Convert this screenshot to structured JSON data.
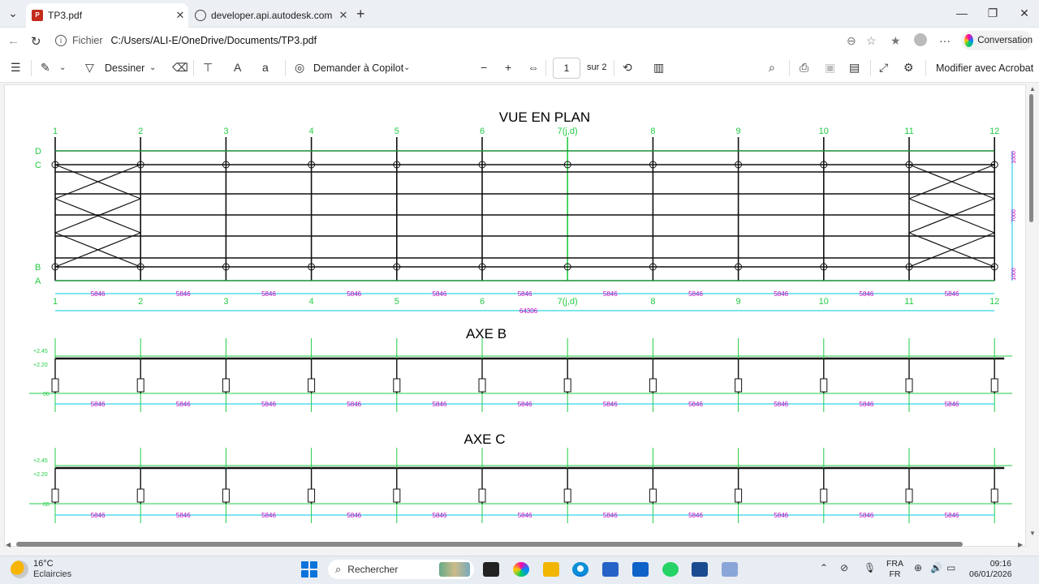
{
  "browser": {
    "tabs": [
      {
        "title": "TP3.pdf",
        "active": true
      },
      {
        "title": "developer.api.autodesk.com",
        "active": false
      }
    ],
    "address": {
      "protocol": "Fichier",
      "url": "C:/Users/ALI-E/OneDrive/Documents/TP3.pdf"
    },
    "copilot_label": "Conversation"
  },
  "pdf_toolbar": {
    "draw_label": "Dessiner",
    "ask_copilot_label": "Demander à Copilot",
    "page_current": "1",
    "page_total": "sur 2",
    "edit_acrobat_label": "Modifier avec Acrobat"
  },
  "drawing": {
    "plan": {
      "title": "VUE EN PLAN",
      "axes": [
        "1",
        "2",
        "3",
        "4",
        "5",
        "6",
        "7(j,d)",
        "8",
        "9",
        "10",
        "11",
        "12"
      ],
      "rows": [
        "D",
        "C",
        "B",
        "A"
      ],
      "spans": [
        "5846",
        "5846",
        "5846",
        "5846",
        "5846",
        "5846",
        "5846",
        "5846",
        "5846",
        "5846",
        "5846"
      ],
      "total": "64306",
      "side_dims": [
        "1000",
        "7000",
        "1000"
      ]
    },
    "axe_b": {
      "title": "AXE B",
      "levels": [
        "+2.45",
        "+2.20",
        "00"
      ],
      "spans": [
        "5846",
        "5846",
        "5846",
        "5846",
        "5846",
        "5846",
        "5846",
        "5846",
        "5846",
        "5846",
        "5846"
      ]
    },
    "axe_c": {
      "title": "AXE C",
      "levels": [
        "+2.45",
        "+2.20",
        "00"
      ],
      "spans": [
        "5846",
        "5846",
        "5846",
        "5846",
        "5846",
        "5846",
        "5846",
        "5846",
        "5846",
        "5846",
        "5846"
      ]
    }
  },
  "taskbar": {
    "temp": "16°C",
    "weather": "Eclaircies",
    "search_placeholder": "Rechercher",
    "lang1": "FRA",
    "lang2": "FR",
    "time": "09:16",
    "date": "06/01/2026"
  },
  "colors": {
    "grid_green": "#22cc44",
    "dim_cyan": "#00c8e0",
    "dim_magenta": "#c000c0",
    "beam_label": "#3a3ab0"
  }
}
